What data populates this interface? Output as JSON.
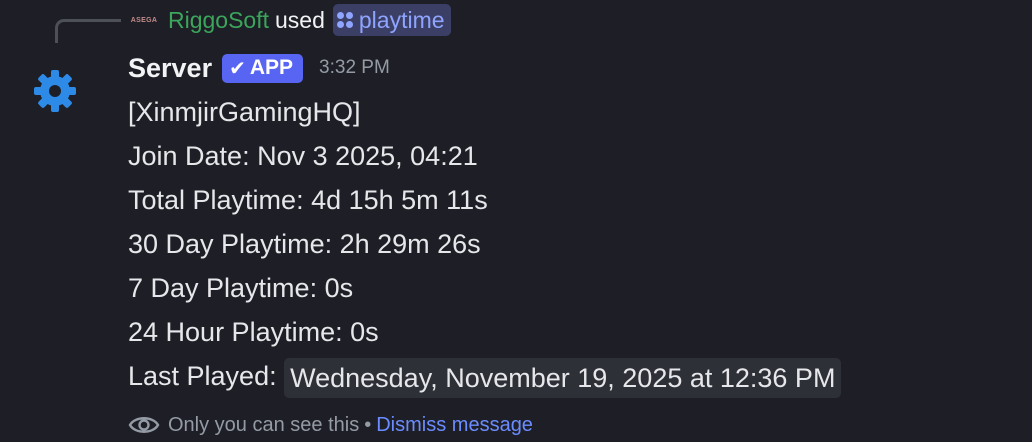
{
  "reply": {
    "avatar_text": "ASEGA",
    "username": "RiggoSoft",
    "used_text": "used",
    "command": "playtime",
    "user_color": "#3ba55c",
    "command_color": "#8fa4ff"
  },
  "message": {
    "avatar_icon": "gear-icon",
    "author": "Server",
    "badge": "APP",
    "badge_color": "#5865f2",
    "timestamp": "3:32 PM",
    "lines": {
      "server_tag": "[XinmjirGamingHQ]",
      "join_date": "Join Date: Nov 3 2025, 04:21",
      "total_playtime": "Total Playtime: 4d 15h 5m 11s",
      "playtime_30d": "30 Day Playtime: 2h 29m 26s",
      "playtime_7d": "7 Day Playtime: 0s",
      "playtime_24h": "24 Hour Playtime: 0s",
      "last_played_label": "Last Played:",
      "last_played_value": "Wednesday, November 19, 2025 at 12:36 PM"
    }
  },
  "footer": {
    "icon": "eye-icon",
    "visibility_text": "Only you can see this",
    "separator": "•",
    "dismiss_label": "Dismiss message"
  }
}
